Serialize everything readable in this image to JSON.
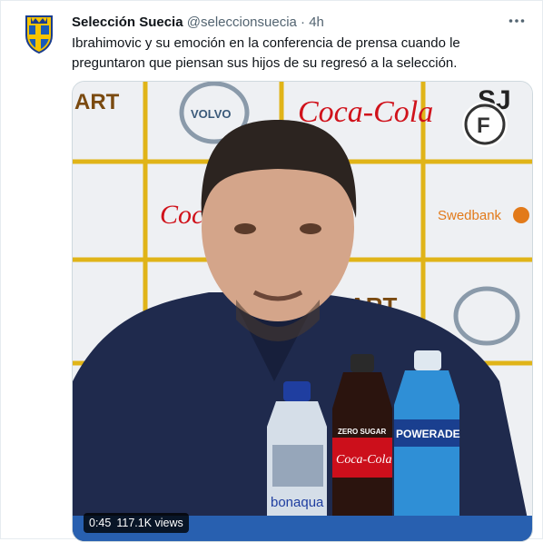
{
  "tweet": {
    "author_name": "Selección Suecia",
    "handle": "@seleccionsuecia",
    "separator": "·",
    "time": "4h",
    "text": "Ibrahimovic y su emoción en la conferencia de prensa cuando le preguntaron que piensan sus hijos de su regresó a la selección.",
    "more_icon": "more-horizontal-icon"
  },
  "video": {
    "duration": "0:45",
    "views": "117.1K views",
    "logo_letter": "F",
    "sponsors": {
      "coca_cola": "Coca-Cola",
      "volvo": "VOLVO",
      "swedbank": "Swedbank",
      "sj": "SJ",
      "art": "ART",
      "bonaqua": "bonaqua",
      "zero_sugar": "ZERO SUGAR",
      "powerade": "POWERADE"
    }
  }
}
